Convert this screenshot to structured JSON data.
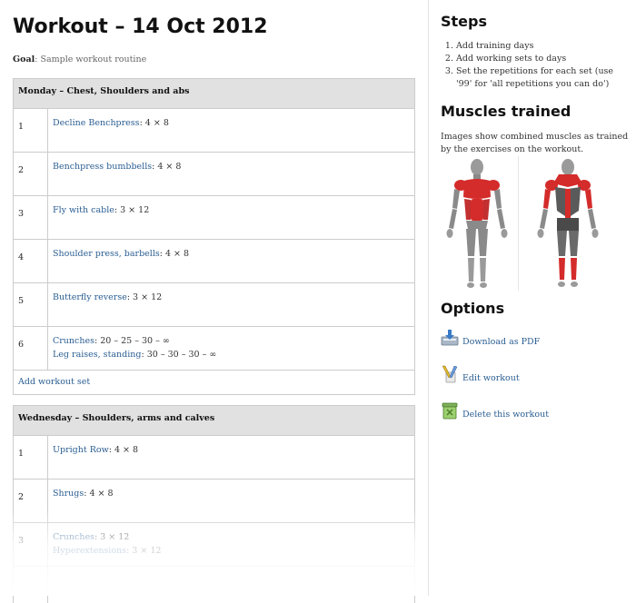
{
  "workout": {
    "title": "Workout – 14 Oct 2012",
    "goal_label": "Goal",
    "goal_text": "Sample workout routine"
  },
  "days": [
    {
      "header": "Monday – Chest, Shoulders and abs",
      "sets": [
        {
          "num": "1",
          "exercises": [
            {
              "name": "Decline Benchpress",
              "reps": "4 × 8"
            }
          ]
        },
        {
          "num": "2",
          "exercises": [
            {
              "name": "Benchpress bumbbells",
              "reps": "4 × 8"
            }
          ]
        },
        {
          "num": "3",
          "exercises": [
            {
              "name": "Fly with cable",
              "reps": "3 × 12"
            }
          ]
        },
        {
          "num": "4",
          "exercises": [
            {
              "name": "Shoulder press, barbells",
              "reps": "4 × 8"
            }
          ]
        },
        {
          "num": "5",
          "exercises": [
            {
              "name": "Butterfly reverse",
              "reps": "3 × 12"
            }
          ]
        },
        {
          "num": "6",
          "exercises": [
            {
              "name": "Crunches",
              "reps": "20 – 25 – 30 – ∞"
            },
            {
              "name": "Leg raises, standing",
              "reps": "30 – 30 – 30 – ∞"
            }
          ]
        }
      ],
      "add_set_label": "Add workout set"
    },
    {
      "header": "Wednesday – Shoulders, arms and calves",
      "sets": [
        {
          "num": "1",
          "exercises": [
            {
              "name": "Upright Row",
              "reps": "4 × 8"
            }
          ]
        },
        {
          "num": "2",
          "exercises": [
            {
              "name": "Shrugs",
              "reps": "4 × 8"
            }
          ]
        },
        {
          "num": "3",
          "exercises": [
            {
              "name": "Crunches",
              "reps": "3 × 12"
            },
            {
              "name": "Hyperextensions",
              "reps": "3 × 12"
            }
          ]
        }
      ]
    }
  ],
  "sidebar": {
    "steps_title": "Steps",
    "steps": [
      "Add training days",
      "Add working sets to days",
      "Set the repetitions for each set (use '99' for 'all repetitions you can do')"
    ],
    "muscles_title": "Muscles trained",
    "muscles_text": "Images show combined muscles as trained by the exercises on the workout.",
    "options_title": "Options",
    "options": [
      {
        "label": "Download as PDF",
        "icon": "download-pdf-icon"
      },
      {
        "label": "Edit workout",
        "icon": "edit-icon"
      },
      {
        "label": "Delete this workout",
        "icon": "delete-icon"
      }
    ],
    "colors": {
      "muscle": "#d42b2b",
      "body": "#8a8a8a",
      "link": "#2a5e92"
    }
  }
}
